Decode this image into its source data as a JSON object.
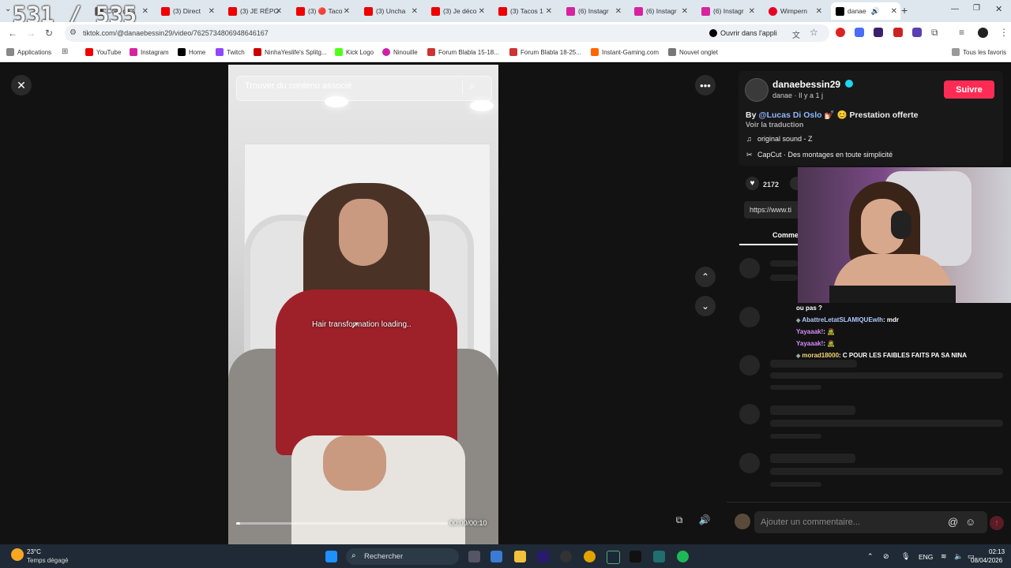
{
  "overlay": {
    "counter": "531 / 535"
  },
  "tabs": [
    {
      "label": "Coût du s",
      "color": "#555"
    },
    {
      "label": "(3) Direct",
      "color": "#e00"
    },
    {
      "label": "(3) JE RÉPO",
      "color": "#e00"
    },
    {
      "label": "(3) 🔴 Taco",
      "color": "#e00"
    },
    {
      "label": "(3) Uncha",
      "color": "#e00"
    },
    {
      "label": "(3) Je déco",
      "color": "#e00"
    },
    {
      "label": "(3) Tacos 1",
      "color": "#e00"
    },
    {
      "label": "(6) Instagr",
      "color": "#d6249f"
    },
    {
      "label": "(6) Instagr",
      "color": "#d6249f"
    },
    {
      "label": "(6) Instagr",
      "color": "#d6249f"
    },
    {
      "label": "Wimpern",
      "color": "#e60023"
    },
    {
      "label": "danae",
      "color": "#000"
    }
  ],
  "address": {
    "url": "tiktok.com/@danaebessin29/video/7625734806948646167",
    "open_app": "Ouvrir dans l'appli"
  },
  "bookmarks": [
    {
      "label": "Applications",
      "color": "#888"
    },
    {
      "label": "YouTube",
      "color": "#e00"
    },
    {
      "label": "Instagram",
      "color": "#d6249f"
    },
    {
      "label": "Home",
      "color": "#000"
    },
    {
      "label": "Twitch",
      "color": "#9146ff"
    },
    {
      "label": "NinhaYeslife's Splitg...",
      "color": "#c00"
    },
    {
      "label": "Kick Logo",
      "color": "#53fc18"
    },
    {
      "label": "Ninouille",
      "color": "#c2a"
    },
    {
      "label": "Forum Blabla 15-18...",
      "color": "#c33"
    },
    {
      "label": "Forum Blabla 18-25...",
      "color": "#c33"
    },
    {
      "label": "Instant-Gaming.com",
      "color": "#f60"
    },
    {
      "label": "Nouvel onglet",
      "color": "#777"
    }
  ],
  "bookmarks_right": "Tous les favoris",
  "video": {
    "search_placeholder": "Trouver du contenu associé",
    "caption": "Hair transformation loading..",
    "time": "00:00/00:10",
    "progress": 0.02
  },
  "profile": {
    "username": "danaebessin29",
    "meta": "danae · Il y a 1 j",
    "follow": "Suivre",
    "desc_by": "By ",
    "desc_mention": "@Lucas Di Oslo",
    "desc_rest": " 💅🏻 😊 Prestation offerte",
    "translate": "Voir la traduction",
    "sound": "original sound - Z",
    "capcut": "CapCut · Des montages en toute simplicité",
    "likes": "2172",
    "link": "https://www.ti",
    "comments_tab": "Comme"
  },
  "chat": [
    {
      "user": "ou pas ?",
      "msg": "",
      "color": "#fff"
    },
    {
      "user": "AbattreLetatSLAMIQUEwlh",
      "msg": ": mdr",
      "color": "#b1c8ff"
    },
    {
      "user": "Yayaaak!",
      "msg": ": 🧟",
      "color": "#d98cff"
    },
    {
      "user": "Yayaaak!",
      "msg": ": 🧟",
      "color": "#d98cff"
    },
    {
      "user": "morad18000",
      "msg": ": C POUR LES FAIBLES FAITS PA SA NINA",
      "color": "#f5d76e"
    }
  ],
  "comment_placeholder": "Ajouter un commentaire...",
  "taskbar": {
    "weather_temp": "23°C",
    "weather_desc": "Temps dégagé",
    "search": "Rechercher",
    "lang": "ENG",
    "time": "02:13",
    "date": "08/04/2026"
  }
}
